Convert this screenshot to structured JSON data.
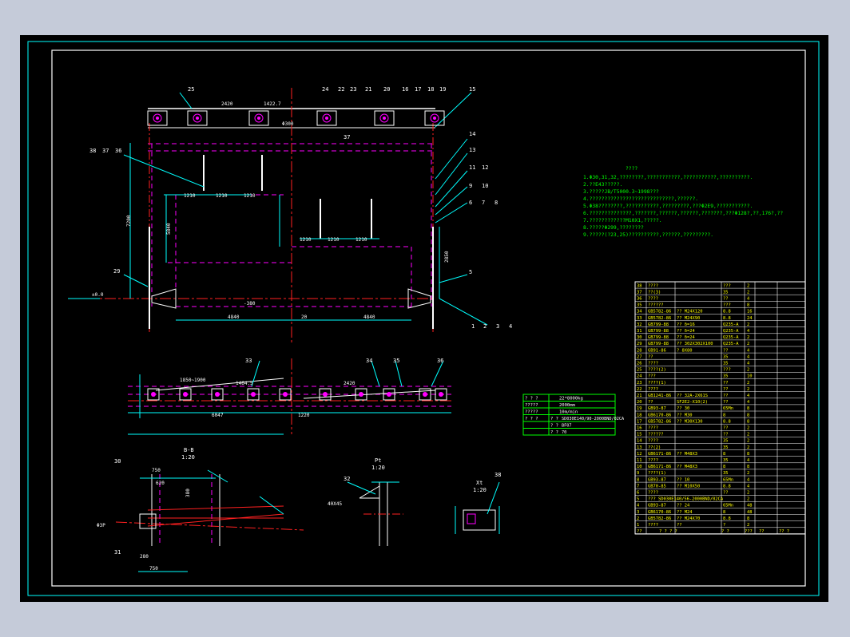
{
  "colors": {
    "frame": "#ffffff",
    "dim": "#00ffff",
    "hidden": "#ff00ff",
    "center": "#ff2020",
    "text": "#ffff00",
    "note": "#00ff00"
  },
  "labels": {
    "top": [
      "25",
      "24",
      "22",
      "23",
      "21",
      "20",
      "16",
      "17",
      "18",
      "19",
      "15"
    ],
    "right": [
      "14",
      "13",
      "11",
      "12",
      "9",
      "10",
      "6",
      "7",
      "8",
      "5",
      "1",
      "2",
      "3",
      "4"
    ],
    "left": [
      "38",
      "37",
      "36",
      "29"
    ],
    "mid": [
      "33",
      "34",
      "35",
      "36",
      "37"
    ],
    "sec": [
      "30",
      "31",
      "32",
      "38"
    ]
  },
  "dims": {
    "top_span": "2420",
    "top_span2": "1422.7",
    "d500": "Φ300",
    "d1210": "1210",
    "d4840": "4840",
    "d20": "20",
    "neg380": "-380",
    "pm00": "±0.0",
    "d7200": "7200",
    "d2850": "2850",
    "d5840": "5840",
    "r1850": "1850~1900",
    "r1464": "1464.5",
    "r2420": "2420",
    "d6047": "6047",
    "d1220": "1220",
    "d750": "750",
    "d620": "620",
    "d380": "380",
    "d280": "280",
    "h_title": "Φ3P",
    "secA": "B-B",
    "secA_scale": "1:20",
    "secB": "Pt",
    "secB_scale": "1:20",
    "secC": "Xt",
    "secC_scale": "1:20",
    "d4045": "40X45"
  },
  "notes": {
    "title": "????",
    "lines": [
      "1.Φ30,31,32,????????,???????????,???????????,??????????.",
      "2.??E43?????.",
      "3.?????JB/T5000.3~1998???",
      "4.????????????????????????????,??????.",
      "5.Φ38????????,???????????,?????????,???Φ2E9,???????????.",
      "6.??????????????,???????,??????,??????,???????,???Φ128?,??,176?,??",
      "7.????????????M10X1,?????.",
      "8.?????Φ299,????????",
      "9.?????(?23,25)??????????,??????,?????????."
    ]
  },
  "spec_table": [
    [
      "? ? ?",
      "22*8000kg"
    ],
    [
      "?????",
      "2000mm"
    ],
    [
      "?????",
      "10m/min"
    ],
    [
      "? ? ?",
      "? ?",
      "SD030E140/90-2000BND/02CA"
    ],
    [
      "",
      "? ?",
      "BF07"
    ],
    [
      "",
      "? ?",
      "70"
    ]
  ],
  "parts": [
    [
      "38",
      "????",
      "???",
      "2"
    ],
    [
      "37",
      "??(3)",
      "35",
      "2"
    ],
    [
      "36",
      "????",
      "??",
      "4"
    ],
    [
      "35",
      "??????",
      "???",
      "8"
    ],
    [
      "34",
      "GB5782-86",
      "?? M24X120",
      "8.8",
      "16"
    ],
    [
      "33",
      "GB5782-86",
      "?? M24X90",
      "8.8",
      "24"
    ],
    [
      "32",
      "GB799-88",
      "?? δ=16",
      "Q235-A",
      "2"
    ],
    [
      "31",
      "GB799-88",
      "?? δ=24",
      "Q235-A",
      "4"
    ],
    [
      "30",
      "GB799-88",
      "?? δ=24",
      "Q235-A",
      "2"
    ],
    [
      "29",
      "GB799-88",
      "?? 302X302X100",
      "Q235-A",
      "2"
    ],
    [
      "28",
      "GB91-86",
      "? 8X80",
      "??",
      "4"
    ],
    [
      "27",
      "??",
      "",
      "35",
      "4"
    ],
    [
      "26",
      "????",
      "",
      "35",
      "4"
    ],
    [
      "25",
      "????(2)",
      "",
      "???",
      "2"
    ],
    [
      "24",
      "???",
      "",
      "35",
      "10"
    ],
    [
      "23",
      "????(1)",
      "",
      "??",
      "2"
    ],
    [
      "22",
      "????",
      "",
      "??",
      "2"
    ],
    [
      "21",
      "GB1241-86",
      "?? 32A-2X61S",
      "??",
      "4"
    ],
    [
      "20",
      "??",
      "SF2E2-X10(2)",
      "??",
      "4"
    ],
    [
      "19",
      "GB93-87",
      "?? 30",
      "65Mn",
      "8"
    ],
    [
      "18",
      "GB6170-86",
      "?? M30",
      "8",
      "8"
    ],
    [
      "17",
      "GB5782-86",
      "?? M30X130",
      "8.8",
      "8"
    ],
    [
      "16",
      "????",
      "",
      "??",
      "2"
    ],
    [
      "15",
      "??????",
      "",
      "??",
      "2"
    ],
    [
      "14",
      "????",
      "",
      "35",
      "2"
    ],
    [
      "13",
      "??(2)",
      "",
      "35",
      "2"
    ],
    [
      "12",
      "GB6171-86",
      "?? M48X3",
      "8",
      "8"
    ],
    [
      "11",
      "????",
      "",
      "35",
      "4"
    ],
    [
      "10",
      "GB6171-86",
      "?? M48X3",
      "8",
      "8"
    ],
    [
      "9",
      "????(1)",
      "",
      "35",
      "2"
    ],
    [
      "8",
      "GB93-87",
      "?? 10",
      "65Mn",
      "4"
    ],
    [
      "7",
      "GB70-85",
      "?? M10X50",
      "8.8",
      "4"
    ],
    [
      "6",
      "????",
      "",
      "??",
      "2"
    ],
    [
      "5",
      "??? SD030E140/56-2000BND/02CA",
      "",
      "",
      "2"
    ],
    [
      "4",
      "GB93-87",
      "?? 24",
      "65Mn",
      "48"
    ],
    [
      "3",
      "GB6170-86",
      "?? M24",
      "8",
      "48"
    ],
    [
      "2",
      "GB5782-86",
      "?? M24X70",
      "8.8",
      "8"
    ],
    [
      "1",
      "????",
      "??",
      "?",
      "2"
    ]
  ],
  "table_footer": [
    "??",
    "? ? ? ?",
    "? ?",
    "???",
    "??",
    "?? ?"
  ]
}
